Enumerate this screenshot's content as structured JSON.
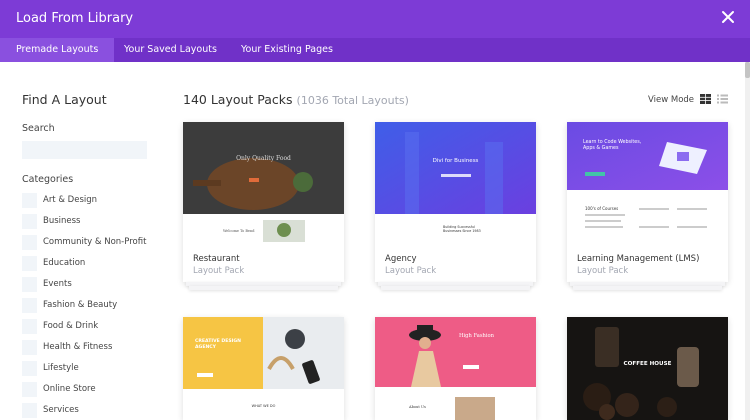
{
  "header": {
    "title": "Load From Library",
    "close_icon": "close-icon"
  },
  "tabs": [
    {
      "label": "Premade Layouts",
      "active": true
    },
    {
      "label": "Your Saved Layouts",
      "active": false
    },
    {
      "label": "Your Existing Pages",
      "active": false
    }
  ],
  "sidebar": {
    "title": "Find A Layout",
    "search_label": "Search",
    "search_placeholder": "",
    "categories_label": "Categories",
    "categories": [
      "Art & Design",
      "Business",
      "Community & Non-Profit",
      "Education",
      "Events",
      "Fashion & Beauty",
      "Food & Drink",
      "Health & Fitness",
      "Lifestyle",
      "Online Store",
      "Services"
    ]
  },
  "main": {
    "title": "140 Layout Packs",
    "subtitle": "(1036 Total Layouts)",
    "view_mode_label": "View Mode",
    "view_icons": [
      "grid-view-icon",
      "list-view-icon"
    ],
    "cards": [
      {
        "name": "Restaurant",
        "type": "Layout Pack",
        "thumb_text": [
          "Only Quality Food",
          "Welcome To Bend"
        ]
      },
      {
        "name": "Agency",
        "type": "Layout Pack",
        "thumb_text": [
          "Divi for Business",
          "Building Successful Businesses Since 1983"
        ]
      },
      {
        "name": "Learning Management (LMS)",
        "type": "Layout Pack",
        "thumb_text": [
          "Learn to Code Websites, Apps & Games",
          "100's of Courses"
        ]
      },
      {
        "name": "",
        "type": "",
        "thumb_text": [
          "CREATIVE DESIGN AGENCY",
          "WHAT WE DO"
        ]
      },
      {
        "name": "",
        "type": "",
        "thumb_text": [
          "High Fashion",
          "About Us"
        ]
      },
      {
        "name": "",
        "type": "",
        "thumb_text": [
          "COFFEE HOUSE"
        ]
      }
    ]
  },
  "colors": {
    "header_bg": "#7d3bd6",
    "tabs_bg": "#7031c8",
    "active_tab": "#8a50df",
    "muted_text": "#a3a7b2"
  }
}
